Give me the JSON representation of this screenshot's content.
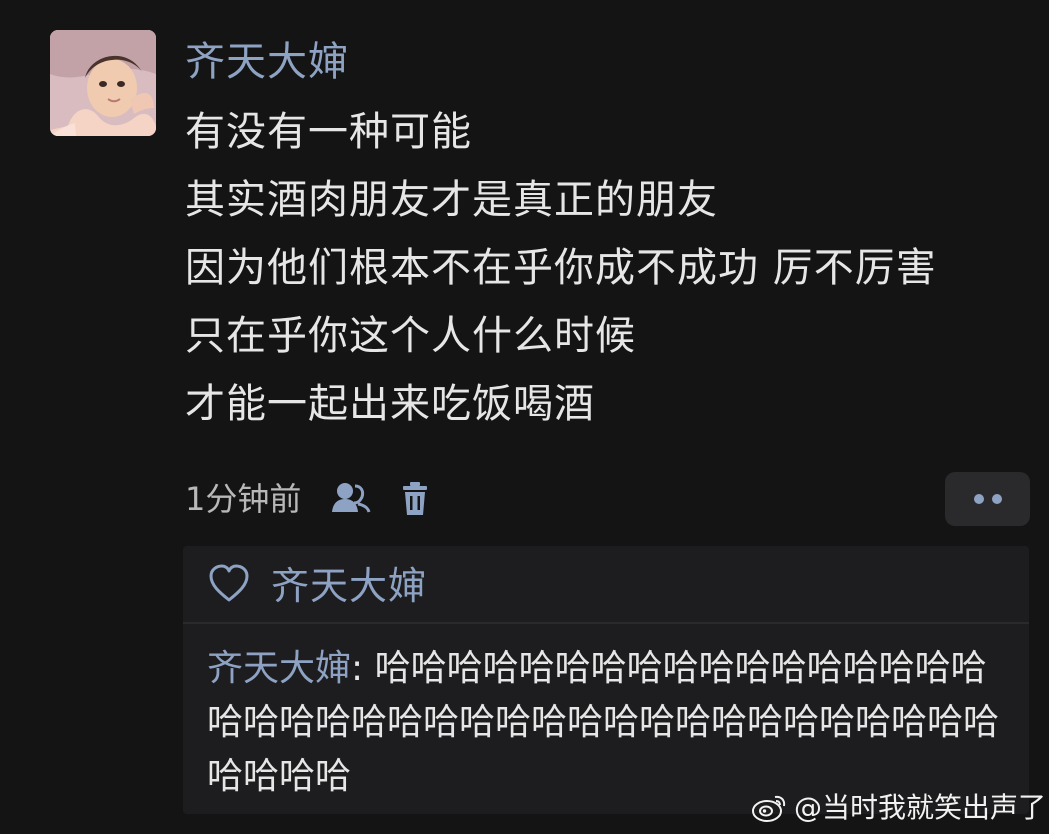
{
  "post": {
    "author": "齐天大婶",
    "lines": [
      "有没有一种可能",
      "其实酒肉朋友才是真正的朋友",
      "因为他们根本不在乎你成不成功 厉不厉害",
      "只在乎你这个人什么时候",
      "才能一起出来吃饭喝酒"
    ],
    "timestamp": "1分钟前"
  },
  "icons": {
    "avatar": "avatar-photo",
    "visibility": "user-visibility-icon",
    "delete": "trash-icon",
    "more": "more-dots-icon",
    "like": "heart-icon",
    "weibo": "weibo-logo-icon"
  },
  "likes": {
    "name": "齐天大婶"
  },
  "comment": {
    "author": "齐天大婶",
    "separator": ": ",
    "text": "哈哈哈哈哈哈哈哈哈哈哈哈哈哈哈哈哈哈哈哈哈哈哈哈哈哈哈哈哈哈哈哈哈哈哈哈哈哈哈哈哈哈哈"
  },
  "watermark": {
    "text": "@当时我就笑出声了"
  },
  "colors": {
    "background": "#141414",
    "card": "#1d1d1f",
    "accent": "#8ea3c4",
    "text": "#e6e6e6",
    "muted": "#b8b8b8"
  }
}
